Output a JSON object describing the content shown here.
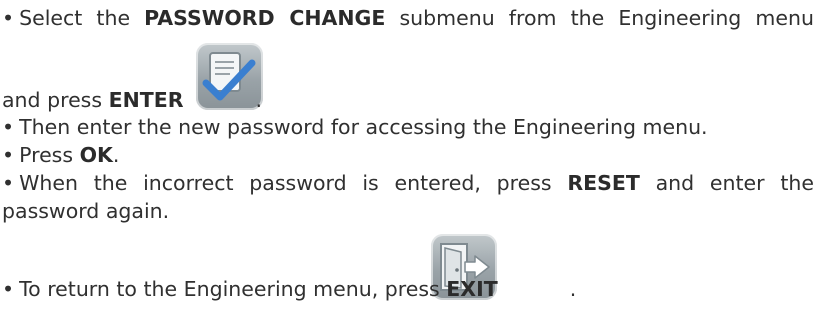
{
  "instructions": {
    "step1": {
      "bullet": "•",
      "prefix": "Select the",
      "bold1": "PASSWORD CHANGE",
      "middle": "submenu from the Engineering menu",
      "line2_prefix": "and press",
      "bold2": "ENTER",
      "suffix": ".",
      "icon": "enter-checkmark-icon"
    },
    "step2": {
      "bullet": "•",
      "text": "Then enter the new password for accessing the Engineering menu."
    },
    "step3": {
      "bullet": "•",
      "prefix": "Press",
      "bold": "OK",
      "suffix": "."
    },
    "step4": {
      "bullet": "•",
      "prefix": "When the incorrect password is entered, press",
      "bold": "RESET",
      "middle": "and enter the",
      "line2": "password again."
    },
    "step5": {
      "bullet": "•",
      "prefix": "To return to the Engineering menu, press",
      "bold": "EXIT",
      "suffix": ".",
      "icon": "exit-door-icon"
    }
  },
  "colors": {
    "text": "#303030",
    "icon_bg": "#9aa3a8",
    "checkmark": "#3a7fd0"
  }
}
